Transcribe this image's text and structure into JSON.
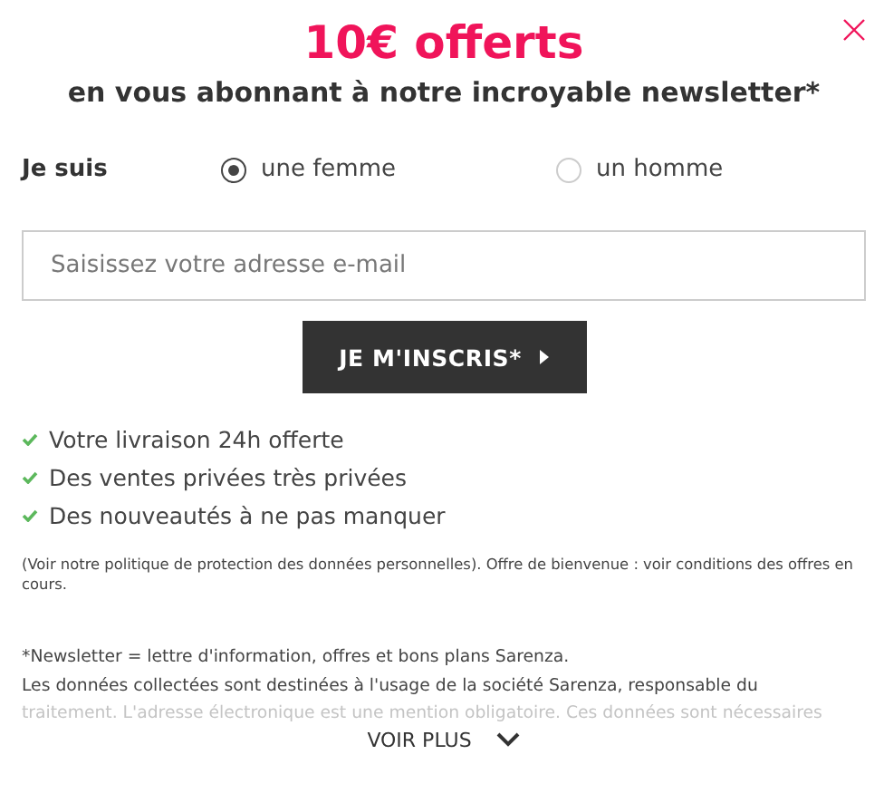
{
  "title": "10€ offerts",
  "subtitle": "en vous abonnant à notre incroyable newsletter*",
  "gender": {
    "label": "Je suis",
    "options": [
      {
        "label": "une femme",
        "selected": true
      },
      {
        "label": "un homme",
        "selected": false
      }
    ]
  },
  "email": {
    "placeholder": "Saisissez votre adresse e-mail"
  },
  "submit": "JE M'INSCRIS*",
  "benefits": [
    "Votre livraison 24h offerte",
    "Des ventes privées très privées",
    "Des nouveautés à ne pas manquer"
  ],
  "privacy": "(Voir notre politique de protection des données personnelles). Offre de bienvenue : voir conditions des offres en cours.",
  "legal": [
    "*Newsletter = lettre d'information, offres et bons plans Sarenza.",
    "Les données collectées sont destinées à l'usage de la société Sarenza, responsable du",
    "traitement. L'adresse électronique est une mention obligatoire. Ces données sont nécessaires"
  ],
  "more": "VOIR PLUS"
}
